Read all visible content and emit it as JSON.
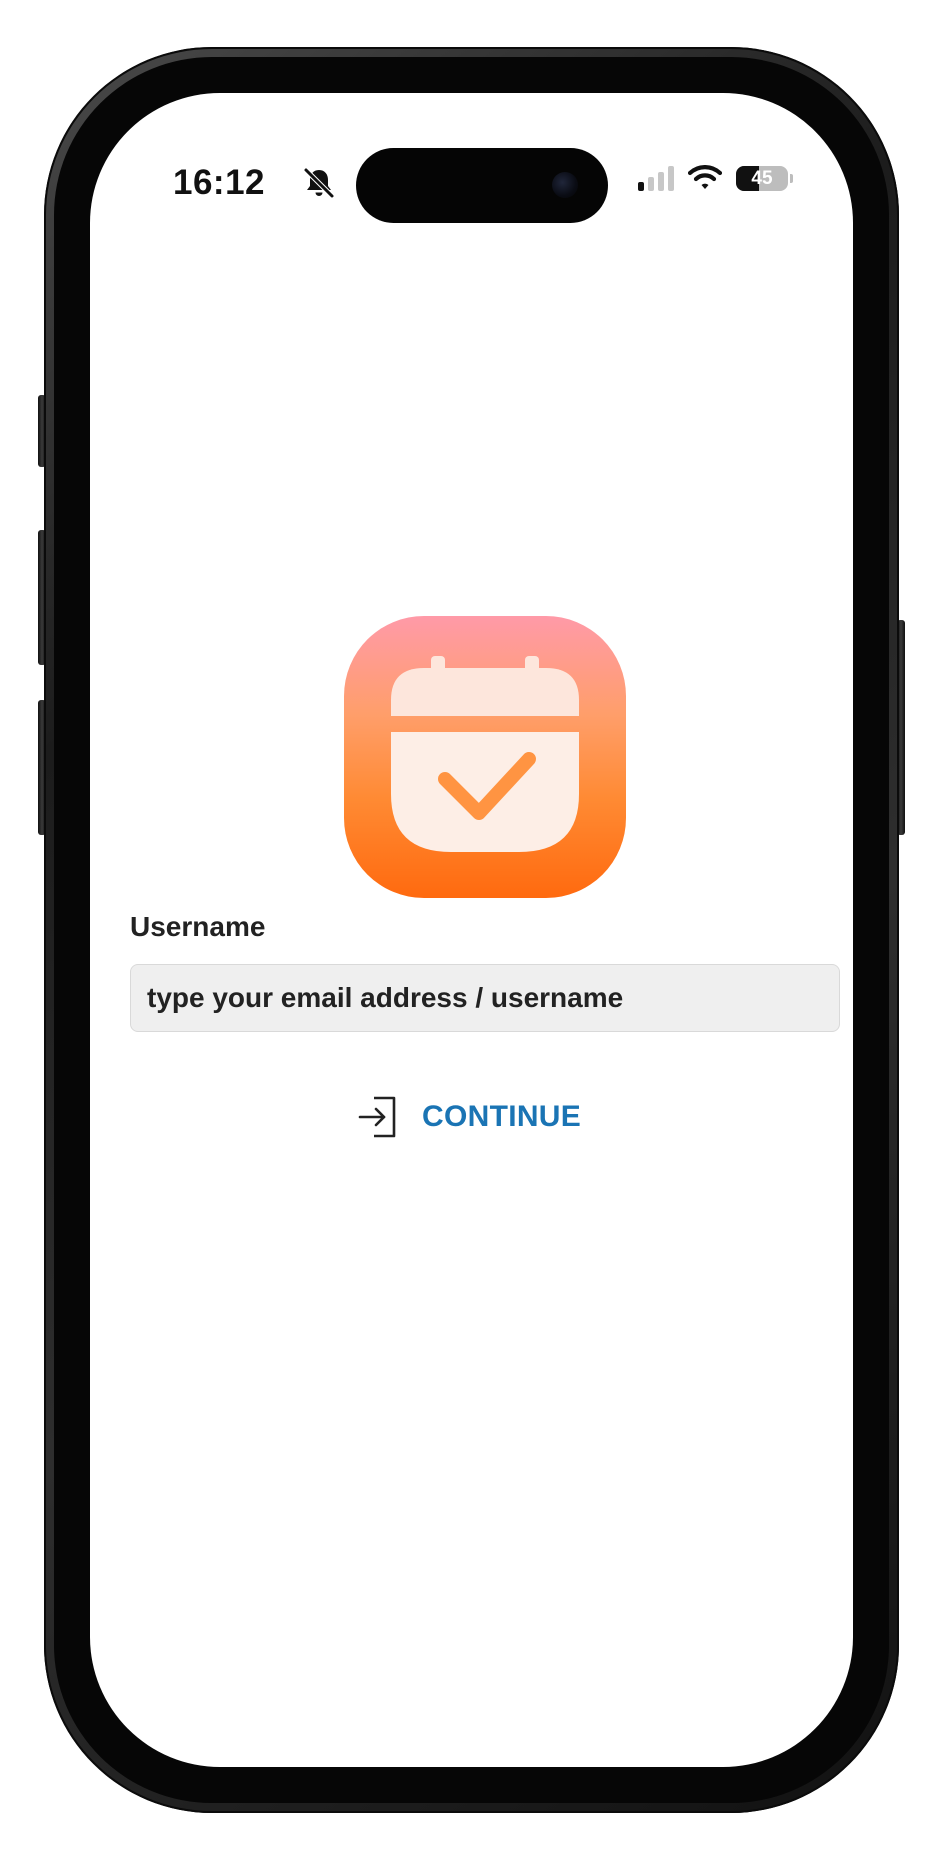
{
  "status_bar": {
    "time": "16:12",
    "battery_level": "45",
    "icons": [
      "bell-slash-icon",
      "cellular-signal-icon",
      "wifi-icon",
      "battery-icon"
    ]
  },
  "app": {
    "logo_icon": "calendar-check-icon",
    "username_label": "Username",
    "username_placeholder": "type your email address / username",
    "username_value": "",
    "continue_label": "CONTINUE",
    "continue_icon": "login-arrow-icon"
  },
  "colors": {
    "accent": "#1a74b4",
    "logo_top": "#ff9aa8",
    "logo_bottom": "#ff6a0f",
    "input_bg": "#efefef"
  }
}
